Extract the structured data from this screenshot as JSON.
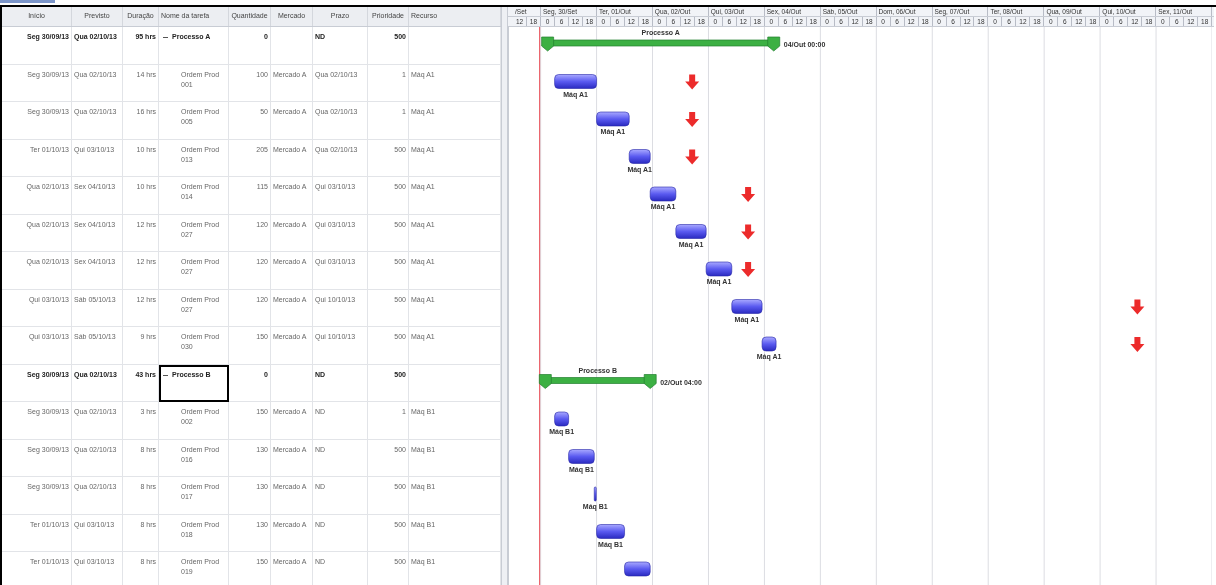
{
  "table": {
    "columns": [
      "Início",
      "Previsto",
      "Duração",
      "Nome da tarefa",
      "Quantidade",
      "Mercado",
      "Prazo",
      "Prioridade",
      "Recurso"
    ],
    "rows": [
      {
        "kind": "summary",
        "expanded": true,
        "selected": false,
        "inicio": "Seg 30/09/13",
        "previsto": "Qua 02/10/13",
        "duracao": "95 hrs",
        "nome": "Processo A",
        "quantidade": "0",
        "prazo": "ND",
        "prioridade": "500",
        "children": [
          {
            "kind": "task",
            "selected": false,
            "inicio": "Seg 30/09/13",
            "previsto": "Qua 02/10/13",
            "duracao": "14 hrs",
            "nome": "Ordem Prod 001",
            "quantidade": "100",
            "mercado": "Mercado A",
            "prazo": "Qua 02/10/13",
            "prioridade": "1",
            "recurso": "Máq A1"
          },
          {
            "kind": "task",
            "selected": false,
            "inicio": "Seg 30/09/13",
            "previsto": "Qua 02/10/13",
            "duracao": "16 hrs",
            "nome": "Ordem Prod 005",
            "quantidade": "50",
            "mercado": "Mercado A",
            "prazo": "Qua 02/10/13",
            "prioridade": "1",
            "recurso": "Máq A1"
          },
          {
            "kind": "task",
            "selected": false,
            "inicio": "Ter 01/10/13",
            "previsto": "Qui 03/10/13",
            "duracao": "10 hrs",
            "nome": "Ordem Prod 013",
            "quantidade": "205",
            "mercado": "Mercado A",
            "prazo": "Qua 02/10/13",
            "prioridade": "500",
            "recurso": "Máq A1"
          },
          {
            "kind": "task",
            "selected": false,
            "inicio": "Qua 02/10/13",
            "previsto": "Sex 04/10/13",
            "duracao": "10 hrs",
            "nome": "Ordem Prod 014",
            "quantidade": "115",
            "mercado": "Mercado A",
            "prazo": "Qui 03/10/13",
            "prioridade": "500",
            "recurso": "Máq A1"
          },
          {
            "kind": "task",
            "selected": false,
            "inicio": "Qua 02/10/13",
            "previsto": "Sex 04/10/13",
            "duracao": "12 hrs",
            "nome": "Ordem Prod 027",
            "quantidade": "120",
            "mercado": "Mercado A",
            "prazo": "Qui 03/10/13",
            "prioridade": "500",
            "recurso": "Máq A1"
          },
          {
            "kind": "task",
            "selected": false,
            "inicio": "Qua 02/10/13",
            "previsto": "Sex 04/10/13",
            "duracao": "12 hrs",
            "nome": "Ordem Prod 027",
            "quantidade": "120",
            "mercado": "Mercado A",
            "prazo": "Qui 03/10/13",
            "prioridade": "500",
            "recurso": "Máq A1"
          },
          {
            "kind": "task",
            "selected": false,
            "inicio": "Qui 03/10/13",
            "previsto": "Sáb 05/10/13",
            "duracao": "12 hrs",
            "nome": "Ordem Prod 027",
            "quantidade": "120",
            "mercado": "Mercado A",
            "prazo": "Qui 10/10/13",
            "prioridade": "500",
            "recurso": "Máq A1"
          },
          {
            "kind": "task",
            "selected": false,
            "inicio": "Qui 03/10/13",
            "previsto": "Sáb 05/10/13",
            "duracao": "9 hrs",
            "nome": "Ordem Prod 030",
            "quantidade": "150",
            "mercado": "Mercado A",
            "prazo": "Qui 10/10/13",
            "prioridade": "500",
            "recurso": "Máq A1"
          }
        ]
      },
      {
        "kind": "summary",
        "expanded": true,
        "selected": true,
        "inicio": "Seg 30/09/13",
        "previsto": "Qua 02/10/13",
        "duracao": "43 hrs",
        "nome": "Processo B",
        "quantidade": "0",
        "prazo": "ND",
        "prioridade": "500",
        "children": [
          {
            "kind": "task",
            "selected": false,
            "inicio": "Seg 30/09/13",
            "previsto": "Qua 02/10/13",
            "duracao": "3 hrs",
            "nome": "Ordem Prod 002",
            "quantidade": "150",
            "mercado": "Mercado A",
            "prazo": "ND",
            "prioridade": "1",
            "recurso": "Máq B1"
          },
          {
            "kind": "task",
            "selected": false,
            "inicio": "Seg 30/09/13",
            "previsto": "Qua 02/10/13",
            "duracao": "8 hrs",
            "nome": "Ordem Prod 016",
            "quantidade": "130",
            "mercado": "Mercado A",
            "prazo": "ND",
            "prioridade": "500",
            "recurso": "Máq B1"
          },
          {
            "kind": "task",
            "selected": false,
            "inicio": "Seg 30/09/13",
            "previsto": "Qua 02/10/13",
            "duracao": "8 hrs",
            "nome": "Ordem Prod 017",
            "quantidade": "130",
            "mercado": "Mercado A",
            "prazo": "ND",
            "prioridade": "500",
            "recurso": "Máq B1"
          },
          {
            "kind": "task",
            "selected": false,
            "inicio": "Ter 01/10/13",
            "previsto": "Qui 03/10/13",
            "duracao": "8 hrs",
            "nome": "Ordem Prod 018",
            "quantidade": "130",
            "mercado": "Mercado A",
            "prazo": "ND",
            "prioridade": "500",
            "recurso": "Máq B1"
          },
          {
            "kind": "task",
            "selected": false,
            "inicio": "Ter 01/10/13",
            "previsto": "Qui 03/10/13",
            "duracao": "8 hrs",
            "nome": "Ordem Prod 019",
            "quantidade": "150",
            "mercado": "Mercado A",
            "prazo": "ND",
            "prioridade": "500",
            "recurso": "Máq B1"
          }
        ]
      }
    ]
  },
  "gantt": {
    "days": [
      {
        "label": "/Set",
        "hours": [
          "12",
          "18"
        ]
      },
      {
        "label": "Seg, 30/Set",
        "hours": [
          "0",
          "6",
          "12",
          "18"
        ]
      },
      {
        "label": "Ter, 01/Out",
        "hours": [
          "0",
          "6",
          "12",
          "18"
        ]
      },
      {
        "label": "Qua, 02/Out",
        "hours": [
          "0",
          "6",
          "12",
          "18"
        ]
      },
      {
        "label": "Qui, 03/Out",
        "hours": [
          "0",
          "6",
          "12",
          "18"
        ]
      },
      {
        "label": "Sex, 04/Out",
        "hours": [
          "0",
          "6",
          "12",
          "18"
        ]
      },
      {
        "label": "Sáb, 05/Out",
        "hours": [
          "0",
          "6",
          "12",
          "18"
        ]
      },
      {
        "label": "Dom, 06/Out",
        "hours": [
          "0",
          "6",
          "12",
          "18"
        ]
      },
      {
        "label": "Seg, 07/Out",
        "hours": [
          "0",
          "6",
          "12",
          "18"
        ]
      },
      {
        "label": "Ter, 08/Out",
        "hours": [
          "0",
          "6",
          "12",
          "18"
        ]
      },
      {
        "label": "Qua, 09/Out",
        "hours": [
          "0",
          "6",
          "12",
          "18"
        ]
      },
      {
        "label": "Qui, 10/Out",
        "hours": [
          "0",
          "6",
          "12",
          "18"
        ]
      },
      {
        "label": "Sex, 11/Out",
        "hours": [
          "0",
          "6",
          "12",
          "18"
        ]
      }
    ],
    "rows": [
      {
        "kind": "summary",
        "label_above": "Processo A",
        "label_right": "04/Out 00:00"
      },
      {
        "kind": "task",
        "label_below": "Máq A1"
      },
      {
        "kind": "task",
        "label_below": "Máq A1"
      },
      {
        "kind": "task",
        "label_below": "Máq A1"
      },
      {
        "kind": "task",
        "label_below": "Máq A1"
      },
      {
        "kind": "task",
        "label_below": "Máq A1"
      },
      {
        "kind": "task",
        "label_below": "Máq A1"
      },
      {
        "kind": "task",
        "label_below": "Máq A1"
      },
      {
        "kind": "task",
        "label_below": "Máq A1"
      },
      {
        "kind": "summary",
        "label_above": "Processo B",
        "label_right": "02/Out 04:00"
      },
      {
        "kind": "task",
        "label_below": "Máq B1"
      },
      {
        "kind": "task",
        "label_below": "Máq B1"
      },
      {
        "kind": "task",
        "label_below": "Máq B1"
      },
      {
        "kind": "task",
        "label_below": "Máq B1"
      },
      {
        "kind": "task"
      }
    ]
  }
}
